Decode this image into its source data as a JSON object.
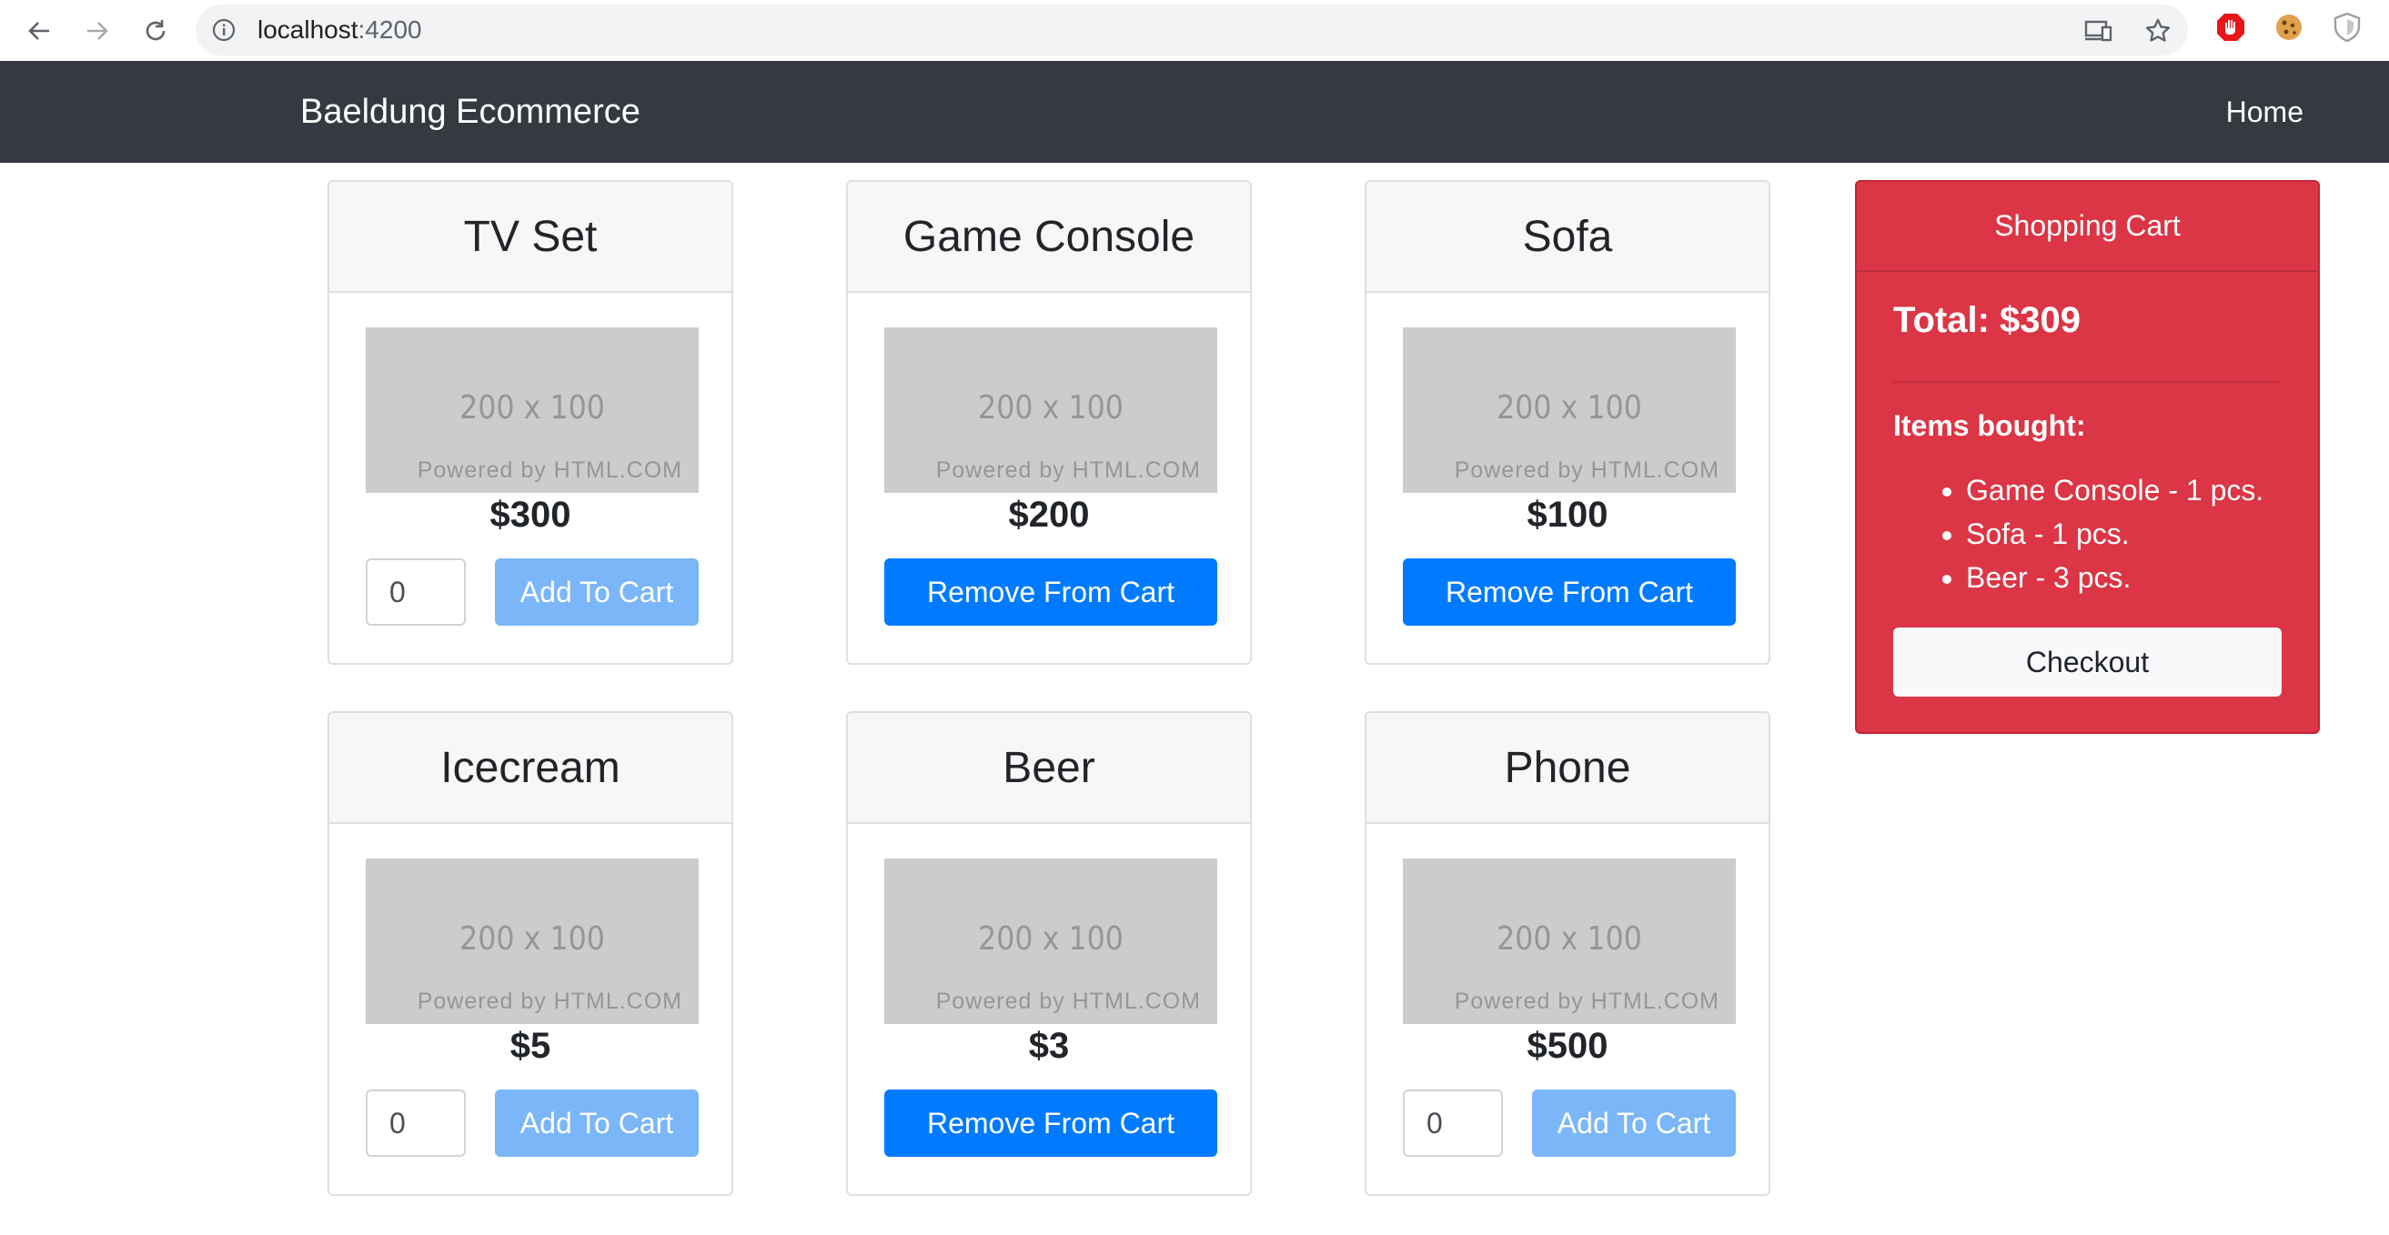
{
  "browser": {
    "url_host": "localhost",
    "url_port": ":4200"
  },
  "navbar": {
    "brand": "Baeldung Ecommerce",
    "home": "Home"
  },
  "placeholder": {
    "size_text": "200 x 100",
    "powered_text": "Powered by HTML.COM"
  },
  "products": [
    {
      "name": "TV Set",
      "price": "$300",
      "quantity": "0",
      "action": "Add To Cart"
    },
    {
      "name": "Game Console",
      "price": "$200",
      "action": "Remove From Cart"
    },
    {
      "name": "Sofa",
      "price": "$100",
      "action": "Remove From Cart"
    },
    {
      "name": "Icecream",
      "price": "$5",
      "quantity": "0",
      "action": "Add To Cart"
    },
    {
      "name": "Beer",
      "price": "$3",
      "action": "Remove From Cart"
    },
    {
      "name": "Phone",
      "price": "$500",
      "quantity": "0",
      "action": "Add To Cart"
    }
  ],
  "cart": {
    "title": "Shopping Cart",
    "total": "Total: $309",
    "items_title": "Items bought:",
    "items": [
      "Game Console - 1 pcs.",
      "Sofa - 1 pcs.",
      "Beer - 3 pcs."
    ],
    "checkout": "Checkout"
  },
  "colors": {
    "navbar": "#343a40",
    "cart": "#dc3545",
    "primary": "#007bff",
    "primary_disabled": "#7ab6f8"
  }
}
